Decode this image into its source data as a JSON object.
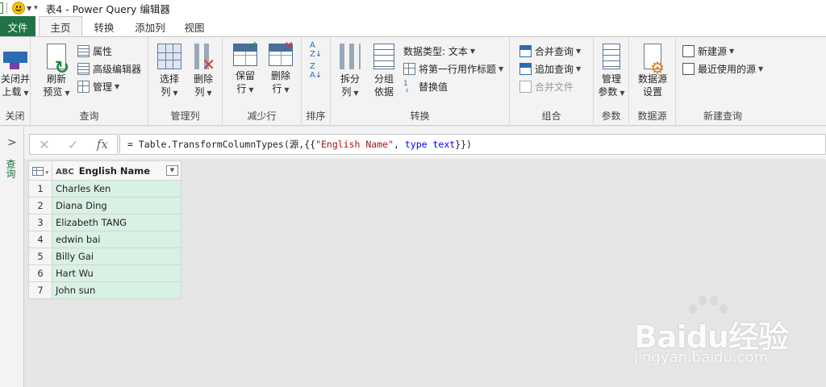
{
  "titlebar": {
    "title": "表4 - Power Query 编辑器"
  },
  "tabs": {
    "file": "文件",
    "home": "主页",
    "transform": "转换",
    "add_column": "添加列",
    "view": "视图"
  },
  "ribbon": {
    "close": {
      "btn1": "关闭并",
      "btn2": "上载",
      "label": "关闭"
    },
    "query": {
      "refresh1": "刷新",
      "refresh2": "预览",
      "properties": "属性",
      "advanced": "高级编辑器",
      "manage": "管理",
      "label": "查询"
    },
    "manage_cols": {
      "choose1": "选择",
      "choose2": "列",
      "remove1": "删除",
      "remove2": "列",
      "label": "管理列"
    },
    "reduce_rows": {
      "keep1": "保留",
      "keep2": "行",
      "remove1": "删除",
      "remove2": "行",
      "label": "减少行"
    },
    "sort": {
      "label": "排序"
    },
    "transform": {
      "split1": "拆分",
      "split2": "列",
      "group1": "分组",
      "group2": "依据",
      "datatype": "数据类型: 文本",
      "first_row": "将第一行用作标题",
      "replace": "替换值",
      "label": "转换"
    },
    "combine": {
      "merge": "合并查询",
      "append": "追加查询",
      "combine_files": "合并文件",
      "label": "组合"
    },
    "params": {
      "manage1": "管理",
      "manage2": "参数",
      "label": "参数"
    },
    "datasource": {
      "settings1": "数据源",
      "settings2": "设置",
      "label": "数据源"
    },
    "new_query": {
      "new_source": "新建源",
      "recent": "最近使用的源",
      "label": "新建查询"
    }
  },
  "nav": {
    "queries_label": "查询"
  },
  "formula": {
    "prefix": "= Table.TransformColumnTypes(源,{{",
    "str": "\"English Name\"",
    "mid": ", ",
    "kw": "type text",
    "suffix": "}})"
  },
  "grid": {
    "column": "English Name",
    "type_glyph": "ABC",
    "rows": [
      {
        "n": "1",
        "v": "Charles Ken"
      },
      {
        "n": "2",
        "v": "Diana Ding"
      },
      {
        "n": "3",
        "v": "Elizabeth TANG"
      },
      {
        "n": "4",
        "v": "edwin bai"
      },
      {
        "n": "5",
        "v": "Billy Gai"
      },
      {
        "n": "6",
        "v": "Hart Wu"
      },
      {
        "n": "7",
        "v": "John sun"
      }
    ]
  },
  "watermark": {
    "brand": "Baidu经验",
    "url": "jingyan.baidu.com"
  },
  "colors": {
    "accent": "#217346",
    "header_underline": "#2bb38a",
    "cell_fill": "#d9f0e4"
  }
}
